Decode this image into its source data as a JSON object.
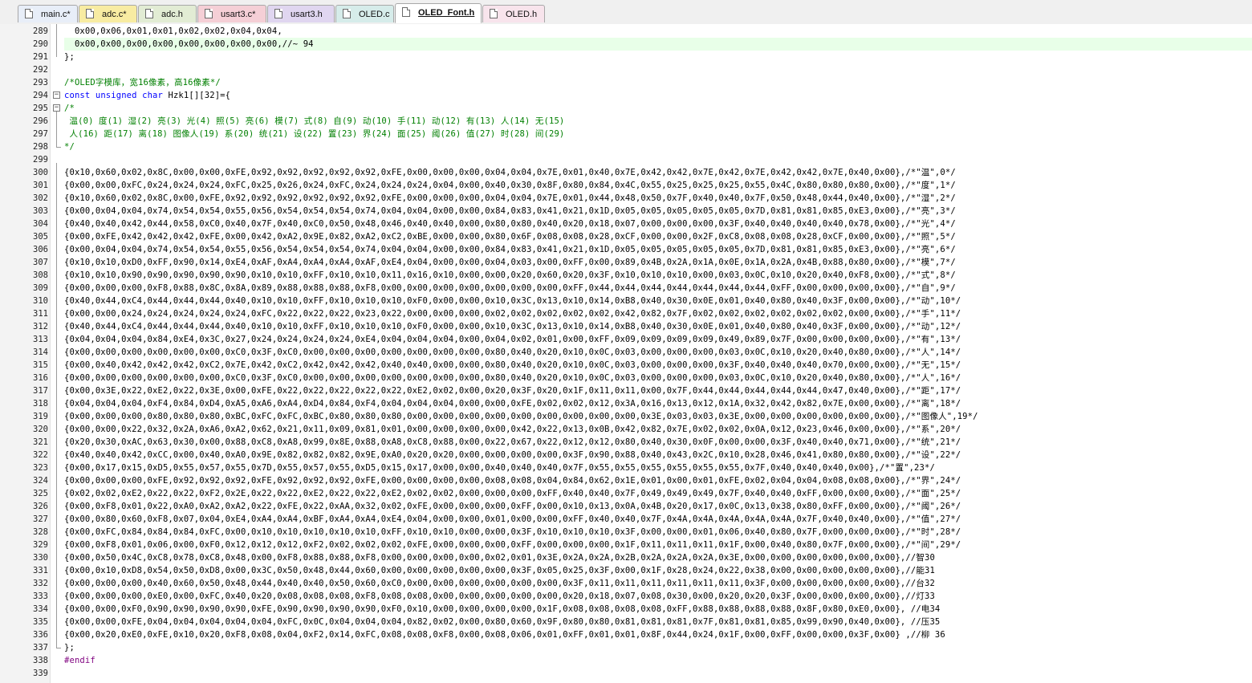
{
  "tabs": [
    {
      "label": "main.c*",
      "color": "#e8eef8",
      "active": false
    },
    {
      "label": "adc.c*",
      "color": "#f8eca2",
      "active": false
    },
    {
      "label": "adc.h",
      "color": "#e2ecd4",
      "active": false
    },
    {
      "label": "usart3.c*",
      "color": "#f5cfd6",
      "active": false
    },
    {
      "label": "usart3.h",
      "color": "#e0d6f0",
      "active": false
    },
    {
      "label": "OLED.c",
      "color": "#d6ecea",
      "active": false
    },
    {
      "label": "OLED_Font.h",
      "color": "#ffffff",
      "active": true
    },
    {
      "label": "OLED.h",
      "color": "#f8e4ec",
      "active": false
    }
  ],
  "editor": {
    "highlight_line": 290,
    "lines": [
      {
        "n": "289",
        "text": "  0x00,0x06,0x01,0x01,0x02,0x02,0x04,0x04,",
        "cls": ""
      },
      {
        "n": "290",
        "text": "  0x00,0x00,0x00,0x00,0x00,0x00,0x00,0x00,//~ 94",
        "cls": ""
      },
      {
        "n": "291",
        "text": "};",
        "cls": ""
      },
      {
        "n": "292",
        "text": "",
        "cls": ""
      },
      {
        "n": "293",
        "text": "/*OLED字模库，宽16像素，高16像素*/",
        "cls": "c-green"
      },
      {
        "n": "294",
        "text": "const unsigned char Hzk1[][32]={",
        "cls": ""
      },
      {
        "n": "295",
        "text": "/*",
        "cls": "c-green"
      },
      {
        "n": "296",
        "text": " 温(0) 度(1) 湿(2) 亮(3) 光(4) 照(5) 亮(6) 模(7) 式(8) 自(9) 动(10) 手(11) 动(12) 有(13) 人(14) 无(15)",
        "cls": "c-green"
      },
      {
        "n": "297",
        "text": " 人(16) 距(17) 离(18) 图像人(19) 系(20) 统(21) 设(22) 置(23) 界(24) 面(25) 阈(26) 值(27) 时(28) 间(29)",
        "cls": "c-green"
      },
      {
        "n": "298",
        "text": "*/",
        "cls": "c-green"
      },
      {
        "n": "299",
        "text": "",
        "cls": ""
      },
      {
        "n": "300",
        "text": "{0x10,0x60,0x02,0x8C,0x00,0x00,0xFE,0x92,0x92,0x92,0x92,0x92,0xFE,0x00,0x00,0x00,0x04,0x04,0x7E,0x01,0x40,0x7E,0x42,0x42,0x7E,0x42,0x7E,0x42,0x42,0x7E,0x40,0x00},/*\"温\",0*/",
        "cls": ""
      },
      {
        "n": "301",
        "text": "{0x00,0x00,0xFC,0x24,0x24,0x24,0xFC,0x25,0x26,0x24,0xFC,0x24,0x24,0x24,0x04,0x00,0x40,0x30,0x8F,0x80,0x84,0x4C,0x55,0x25,0x25,0x25,0x55,0x4C,0x80,0x80,0x80,0x00},/*\"度\",1*/",
        "cls": ""
      },
      {
        "n": "302",
        "text": "{0x10,0x60,0x02,0x8C,0x00,0xFE,0x92,0x92,0x92,0x92,0x92,0x92,0xFE,0x00,0x00,0x00,0x04,0x04,0x7E,0x01,0x44,0x48,0x50,0x7F,0x40,0x40,0x7F,0x50,0x48,0x44,0x40,0x00},/*\"湿\",2*/",
        "cls": ""
      },
      {
        "n": "303",
        "text": "{0x00,0x04,0x04,0x74,0x54,0x54,0x55,0x56,0x54,0x54,0x54,0x74,0x04,0x04,0x00,0x00,0x84,0x83,0x41,0x21,0x1D,0x05,0x05,0x05,0x05,0x05,0x7D,0x81,0x81,0x85,0xE3,0x00},/*\"亮\",3*/",
        "cls": ""
      },
      {
        "n": "304",
        "text": "{0x40,0x40,0x42,0x44,0x58,0xC0,0x40,0x7F,0x40,0xC0,0x50,0x48,0x46,0x40,0x40,0x00,0x80,0x80,0x40,0x20,0x18,0x07,0x00,0x00,0x00,0x3F,0x40,0x40,0x40,0x40,0x78,0x00},/*\"光\",4*/",
        "cls": ""
      },
      {
        "n": "305",
        "text": "{0x00,0xFE,0x42,0x42,0x42,0xFE,0x00,0x42,0xA2,0x9E,0x82,0xA2,0xC2,0xBE,0x00,0x00,0x80,0x6F,0x08,0x08,0x28,0xCF,0x00,0x00,0x2F,0xC8,0x08,0x08,0x28,0xCF,0x00,0x00},/*\"照\",5*/",
        "cls": ""
      },
      {
        "n": "306",
        "text": "{0x00,0x04,0x04,0x74,0x54,0x54,0x55,0x56,0x54,0x54,0x54,0x74,0x04,0x04,0x00,0x00,0x84,0x83,0x41,0x21,0x1D,0x05,0x05,0x05,0x05,0x05,0x7D,0x81,0x81,0x85,0xE3,0x00},/*\"亮\",6*/",
        "cls": ""
      },
      {
        "n": "307",
        "text": "{0x10,0x10,0xD0,0xFF,0x90,0x14,0xE4,0xAF,0xA4,0xA4,0xA4,0xAF,0xE4,0x04,0x00,0x00,0x04,0x03,0x00,0xFF,0x00,0x89,0x4B,0x2A,0x1A,0x0E,0x1A,0x2A,0x4B,0x88,0x80,0x00},/*\"模\",7*/",
        "cls": ""
      },
      {
        "n": "308",
        "text": "{0x10,0x10,0x90,0x90,0x90,0x90,0x90,0x10,0x10,0xFF,0x10,0x10,0x11,0x16,0x10,0x00,0x00,0x20,0x60,0x20,0x3F,0x10,0x10,0x10,0x00,0x03,0x0C,0x10,0x20,0x40,0xF8,0x00},/*\"式\",8*/",
        "cls": ""
      },
      {
        "n": "309",
        "text": "{0x00,0x00,0x00,0xF8,0x88,0x8C,0x8A,0x89,0x88,0x88,0x88,0xF8,0x00,0x00,0x00,0x00,0x00,0x00,0x00,0xFF,0x44,0x44,0x44,0x44,0x44,0x44,0x44,0xFF,0x00,0x00,0x00,0x00},/*\"自\",9*/",
        "cls": ""
      },
      {
        "n": "310",
        "text": "{0x40,0x44,0xC4,0x44,0x44,0x44,0x40,0x10,0x10,0xFF,0x10,0x10,0x10,0xF0,0x00,0x00,0x10,0x3C,0x13,0x10,0x14,0xB8,0x40,0x30,0x0E,0x01,0x40,0x80,0x40,0x3F,0x00,0x00},/*\"动\",10*/",
        "cls": ""
      },
      {
        "n": "311",
        "text": "{0x00,0x00,0x24,0x24,0x24,0x24,0x24,0xFC,0x22,0x22,0x22,0x23,0x22,0x00,0x00,0x00,0x02,0x02,0x02,0x02,0x02,0x42,0x82,0x7F,0x02,0x02,0x02,0x02,0x02,0x02,0x00,0x00},/*\"手\",11*/",
        "cls": ""
      },
      {
        "n": "312",
        "text": "{0x40,0x44,0xC4,0x44,0x44,0x44,0x40,0x10,0x10,0xFF,0x10,0x10,0x10,0xF0,0x00,0x00,0x10,0x3C,0x13,0x10,0x14,0xB8,0x40,0x30,0x0E,0x01,0x40,0x80,0x40,0x3F,0x00,0x00},/*\"动\",12*/",
        "cls": ""
      },
      {
        "n": "313",
        "text": "{0x04,0x04,0x04,0x84,0xE4,0x3C,0x27,0x24,0x24,0x24,0x24,0xE4,0x04,0x04,0x04,0x00,0x04,0x02,0x01,0x00,0xFF,0x09,0x09,0x09,0x09,0x49,0x89,0x7F,0x00,0x00,0x00,0x00},/*\"有\",13*/",
        "cls": ""
      },
      {
        "n": "314",
        "text": "{0x00,0x00,0x00,0x00,0x00,0x00,0xC0,0x3F,0xC0,0x00,0x00,0x00,0x00,0x00,0x00,0x00,0x80,0x40,0x20,0x10,0x0C,0x03,0x00,0x00,0x00,0x03,0x0C,0x10,0x20,0x40,0x80,0x00},/*\"人\",14*/",
        "cls": ""
      },
      {
        "n": "315",
        "text": "{0x00,0x40,0x42,0x42,0x42,0xC2,0x7E,0x42,0xC2,0x42,0x42,0x42,0x40,0x40,0x00,0x00,0x80,0x40,0x20,0x10,0x0C,0x03,0x00,0x00,0x00,0x3F,0x40,0x40,0x40,0x70,0x00,0x00},/*\"无\",15*/",
        "cls": ""
      },
      {
        "n": "316",
        "text": "{0x00,0x00,0x00,0x00,0x00,0x00,0xC0,0x3F,0xC0,0x00,0x00,0x00,0x00,0x00,0x00,0x00,0x80,0x40,0x20,0x10,0x0C,0x03,0x00,0x00,0x00,0x03,0x0C,0x10,0x20,0x40,0x80,0x00},/*\"人\",16*/",
        "cls": ""
      },
      {
        "n": "317",
        "text": "{0x00,0x3E,0x22,0xE2,0x22,0x3E,0x00,0xFE,0x22,0x22,0x22,0x22,0x22,0xE2,0x02,0x00,0x20,0x3F,0x20,0x1F,0x11,0x11,0x00,0x7F,0x44,0x44,0x44,0x44,0x44,0x47,0x40,0x00},/*\"距\",17*/",
        "cls": ""
      },
      {
        "n": "318",
        "text": "{0x04,0x04,0x04,0xF4,0x84,0xD4,0xA5,0xA6,0xA4,0xD4,0x84,0xF4,0x04,0x04,0x04,0x00,0x00,0xFE,0x02,0x02,0x12,0x3A,0x16,0x13,0x12,0x1A,0x32,0x42,0x82,0x7E,0x00,0x00},/*\"离\",18*/",
        "cls": ""
      },
      {
        "n": "319",
        "text": "{0x00,0x00,0x00,0x80,0x80,0x80,0xBC,0xFC,0xFC,0xBC,0x80,0x80,0x80,0x00,0x00,0x00,0x00,0x00,0x00,0x00,0x00,0x00,0x3E,0x03,0x03,0x3E,0x00,0x00,0x00,0x00,0x00,0x00},/*\"图像人\",19*/",
        "cls": ""
      },
      {
        "n": "320",
        "text": "{0x00,0x00,0x22,0x32,0x2A,0xA6,0xA2,0x62,0x21,0x11,0x09,0x81,0x01,0x00,0x00,0x00,0x00,0x42,0x22,0x13,0x0B,0x42,0x82,0x7E,0x02,0x02,0x0A,0x12,0x23,0x46,0x00,0x00},/*\"系\",20*/",
        "cls": ""
      },
      {
        "n": "321",
        "text": "{0x20,0x30,0xAC,0x63,0x30,0x00,0x88,0xC8,0xA8,0x99,0x8E,0x88,0xA8,0xC8,0x88,0x00,0x22,0x67,0x22,0x12,0x12,0x80,0x40,0x30,0x0F,0x00,0x00,0x3F,0x40,0x40,0x71,0x00},/*\"统\",21*/",
        "cls": ""
      },
      {
        "n": "322",
        "text": "{0x40,0x40,0x42,0xCC,0x00,0x40,0xA0,0x9E,0x82,0x82,0x82,0x9E,0xA0,0x20,0x20,0x00,0x00,0x00,0x00,0x3F,0x90,0x88,0x40,0x43,0x2C,0x10,0x28,0x46,0x41,0x80,0x80,0x00},/*\"设\",22*/",
        "cls": ""
      },
      {
        "n": "323",
        "text": "{0x00,0x17,0x15,0xD5,0x55,0x57,0x55,0x7D,0x55,0x57,0x55,0xD5,0x15,0x17,0x00,0x00,0x40,0x40,0x40,0x7F,0x55,0x55,0x55,0x55,0x55,0x55,0x7F,0x40,0x40,0x40,0x00},/*\"置\",23*/",
        "cls": ""
      },
      {
        "n": "324",
        "text": "{0x00,0x00,0x00,0xFE,0x92,0x92,0x92,0xFE,0x92,0x92,0x92,0xFE,0x00,0x00,0x00,0x00,0x08,0x08,0x04,0x84,0x62,0x1E,0x01,0x00,0x01,0xFE,0x02,0x04,0x04,0x08,0x08,0x00},/*\"界\",24*/",
        "cls": ""
      },
      {
        "n": "325",
        "text": "{0x02,0x02,0xE2,0x22,0x22,0xF2,0x2E,0x22,0x22,0xE2,0x22,0x22,0xE2,0x02,0x02,0x00,0x00,0x00,0xFF,0x40,0x40,0x7F,0x49,0x49,0x49,0x7F,0x40,0x40,0xFF,0x00,0x00,0x00},/*\"面\",25*/",
        "cls": ""
      },
      {
        "n": "326",
        "text": "{0x00,0xF8,0x01,0x22,0xA0,0xA2,0xA2,0x22,0xFE,0x22,0xAA,0x32,0x02,0xFE,0x00,0x00,0x00,0xFF,0x00,0x10,0x13,0x0A,0x4B,0x20,0x17,0x0C,0x13,0x38,0x80,0xFF,0x00,0x00},/*\"阈\",26*/",
        "cls": ""
      },
      {
        "n": "327",
        "text": "{0x00,0x80,0x60,0xF8,0x07,0x04,0xE4,0xA4,0xA4,0xBF,0xA4,0xA4,0xE4,0x04,0x00,0x00,0x01,0x00,0x00,0xFF,0x40,0x40,0x7F,0x4A,0x4A,0x4A,0x4A,0x4A,0x7F,0x40,0x40,0x00},/*\"值\",27*/",
        "cls": ""
      },
      {
        "n": "328",
        "text": "{0x00,0xFC,0x84,0x84,0x84,0xFC,0x00,0x10,0x10,0x10,0x10,0x10,0xFF,0x10,0x10,0x00,0x00,0x3F,0x10,0x10,0x10,0x3F,0x00,0x00,0x01,0x06,0x40,0x80,0x7F,0x00,0x00,0x00},/*\"时\",28*/",
        "cls": ""
      },
      {
        "n": "329",
        "text": "{0x00,0xF8,0x01,0x06,0x00,0xF0,0x12,0x12,0x12,0xF2,0x02,0x02,0x02,0xFE,0x00,0x00,0x00,0xFF,0x00,0x00,0x00,0x1F,0x11,0x11,0x11,0x1F,0x00,0x40,0x80,0x7F,0x00,0x00},/*\"间\",29*/",
        "cls": ""
      },
      {
        "n": "330",
        "text": "{0x00,0x50,0x4C,0xC8,0x78,0xC8,0x48,0x00,0xF8,0x88,0x88,0xF8,0x00,0x00,0x00,0x00,0x02,0x01,0x3E,0x2A,0x2A,0x2B,0x2A,0x2A,0x2A,0x3E,0x00,0x00,0x00,0x00,0x00,0x00},//智30",
        "cls": ""
      },
      {
        "n": "331",
        "text": "{0x00,0x10,0xD8,0x54,0x50,0xD8,0x00,0x3C,0x50,0x48,0x44,0x60,0x00,0x00,0x00,0x00,0x00,0x3F,0x05,0x25,0x3F,0x00,0x1F,0x28,0x24,0x22,0x38,0x00,0x00,0x00,0x00,0x00},//能31",
        "cls": ""
      },
      {
        "n": "332",
        "text": "{0x00,0x00,0x00,0x40,0x60,0x50,0x48,0x44,0x40,0x40,0x50,0x60,0xC0,0x00,0x00,0x00,0x00,0x00,0x00,0x3F,0x11,0x11,0x11,0x11,0x11,0x11,0x3F,0x00,0x00,0x00,0x00,0x00},//台32",
        "cls": ""
      },
      {
        "n": "333",
        "text": "{0x00,0x00,0x00,0xE0,0x00,0xFC,0x40,0x20,0x08,0x08,0x08,0xF8,0x08,0x08,0x00,0x00,0x00,0x00,0x00,0x20,0x18,0x07,0x08,0x30,0x00,0x20,0x20,0x3F,0x00,0x00,0x00,0x00},//灯33",
        "cls": ""
      },
      {
        "n": "334",
        "text": "{0x00,0x00,0xF0,0x90,0x90,0x90,0x90,0xFE,0x90,0x90,0x90,0x90,0xF0,0x10,0x00,0x00,0x00,0x00,0x1F,0x08,0x08,0x08,0x08,0xFF,0x88,0x88,0x88,0x88,0x8F,0x80,0xE0,0x00}, //电34",
        "cls": ""
      },
      {
        "n": "335",
        "text": "{0x00,0x00,0xFE,0x04,0x04,0x04,0x04,0x04,0xFC,0x0C,0x04,0x04,0x04,0x82,0x02,0x00,0x80,0x60,0x9F,0x80,0x80,0x81,0x81,0x81,0x7F,0x81,0x81,0x85,0x99,0x90,0x40,0x00}, //压35",
        "cls": ""
      },
      {
        "n": "336",
        "text": "{0x00,0x20,0xE0,0xFE,0x10,0x20,0xF8,0x08,0x04,0xF2,0x14,0xFC,0x08,0x08,0xF8,0x00,0x08,0x06,0x01,0xFF,0x01,0x01,0x8F,0x44,0x24,0x1F,0x00,0xFF,0x00,0x00,0x3F,0x00} ,//柳 36",
        "cls": ""
      },
      {
        "n": "337",
        "text": "};",
        "cls": ""
      },
      {
        "n": "338",
        "text": "#endif",
        "cls": "c-purple"
      },
      {
        "n": "339",
        "text": "",
        "cls": ""
      }
    ]
  }
}
